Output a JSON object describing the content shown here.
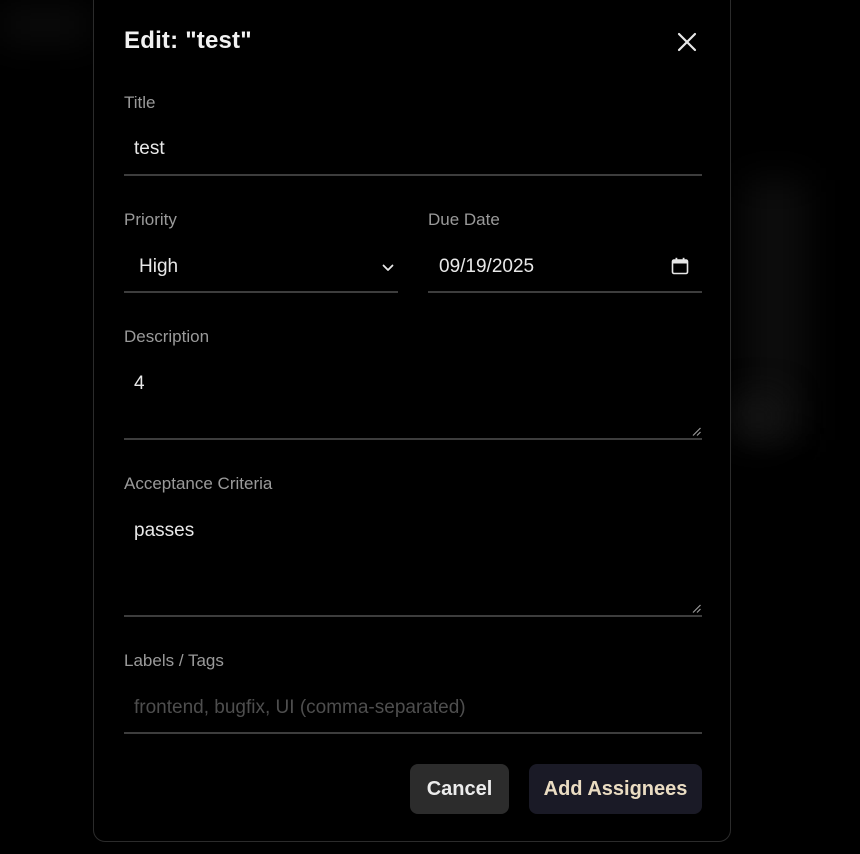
{
  "modal": {
    "title": "Edit: \"test\"",
    "close_icon": "close-icon"
  },
  "form": {
    "title": {
      "label": "Title",
      "value": "test"
    },
    "priority": {
      "label": "Priority",
      "value": "High",
      "icon": "chevron-down-icon"
    },
    "due_date": {
      "label": "Due Date",
      "value": "09/19/2025",
      "icon": "calendar-icon"
    },
    "description": {
      "label": "Description",
      "value": "4"
    },
    "acceptance": {
      "label": "Acceptance Criteria",
      "value": "passes"
    },
    "labels": {
      "label": "Labels / Tags",
      "value": "",
      "placeholder": "frontend, bugfix, UI (comma-separated)"
    }
  },
  "actions": {
    "cancel_label": "Cancel",
    "add_assignees_label": "Add Assignees"
  },
  "colors": {
    "background": "#000000",
    "modal_border": "#2b2b2b",
    "label": "#9a9a9a",
    "underline": "#3d3d3d",
    "cancel_bg": "#2c2c2c",
    "primary_bg": "#1a1a26",
    "primary_text": "#eadcc2"
  }
}
